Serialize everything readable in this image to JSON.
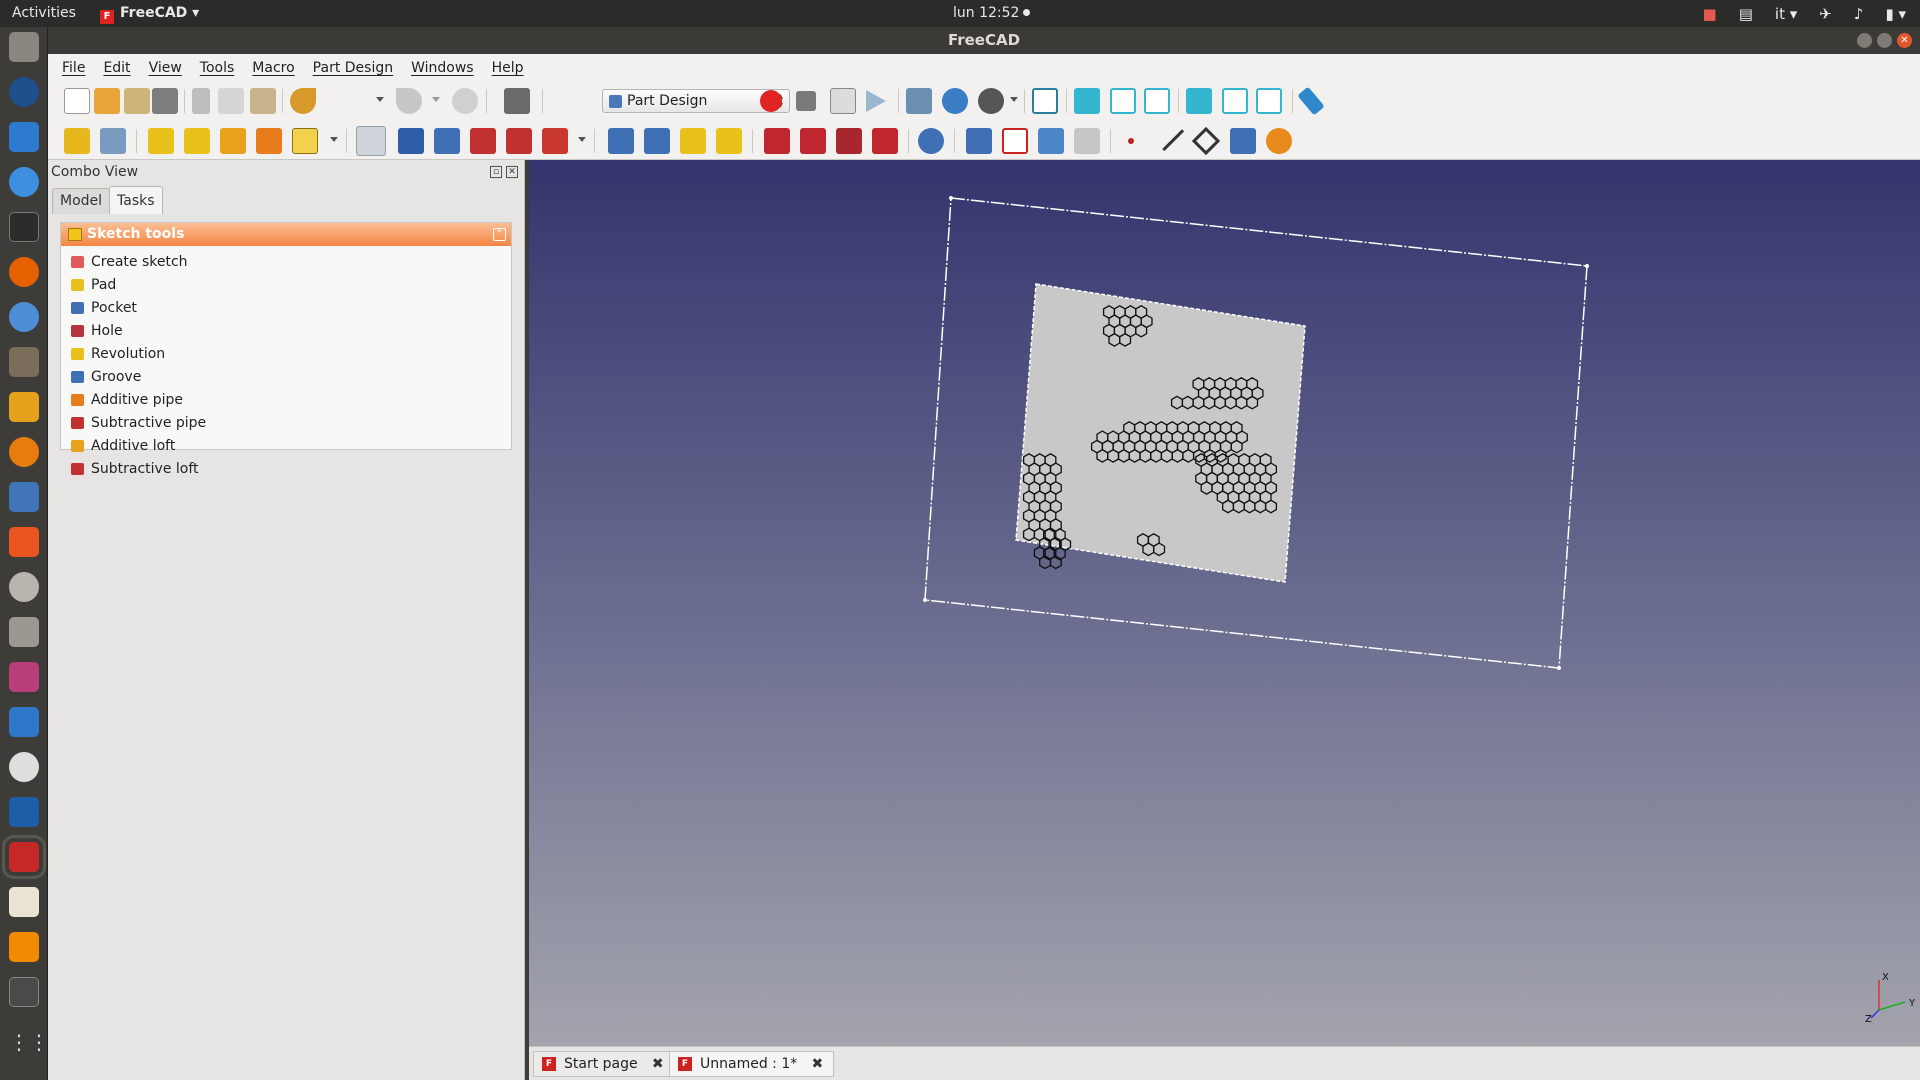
{
  "topbar": {
    "activities": "Activities",
    "app_name": "FreeCAD",
    "clock": "lun 12:52",
    "language": "it"
  },
  "window": {
    "title": "FreeCAD"
  },
  "menu": {
    "file": "File",
    "edit": "Edit",
    "view": "View",
    "tools": "Tools",
    "macro": "Macro",
    "part_design": "Part Design",
    "windows": "Windows",
    "help": "Help"
  },
  "toolbar": {
    "workbench": "Part Design"
  },
  "combo": {
    "title": "Combo View",
    "tab_model": "Model",
    "tab_tasks": "Tasks",
    "panel_title": "Sketch tools",
    "items": [
      {
        "label": "Create sketch",
        "color": "#e05a5a"
      },
      {
        "label": "Pad",
        "color": "#e8c21b"
      },
      {
        "label": "Pocket",
        "color": "#3f6fb5"
      },
      {
        "label": "Hole",
        "color": "#b5333a"
      },
      {
        "label": "Revolution",
        "color": "#e8c21b"
      },
      {
        "label": "Groove",
        "color": "#3f6fb5"
      },
      {
        "label": "Additive pipe",
        "color": "#e87b1b"
      },
      {
        "label": "Subtractive pipe",
        "color": "#c23131"
      },
      {
        "label": "Additive loft",
        "color": "#e8a21b"
      },
      {
        "label": "Subtractive loft",
        "color": "#c23131"
      }
    ]
  },
  "documents": {
    "start_page": "Start page",
    "unnamed": "Unnamed : 1*"
  },
  "axis": {
    "x": "X",
    "y": "Y",
    "z": "Z"
  }
}
